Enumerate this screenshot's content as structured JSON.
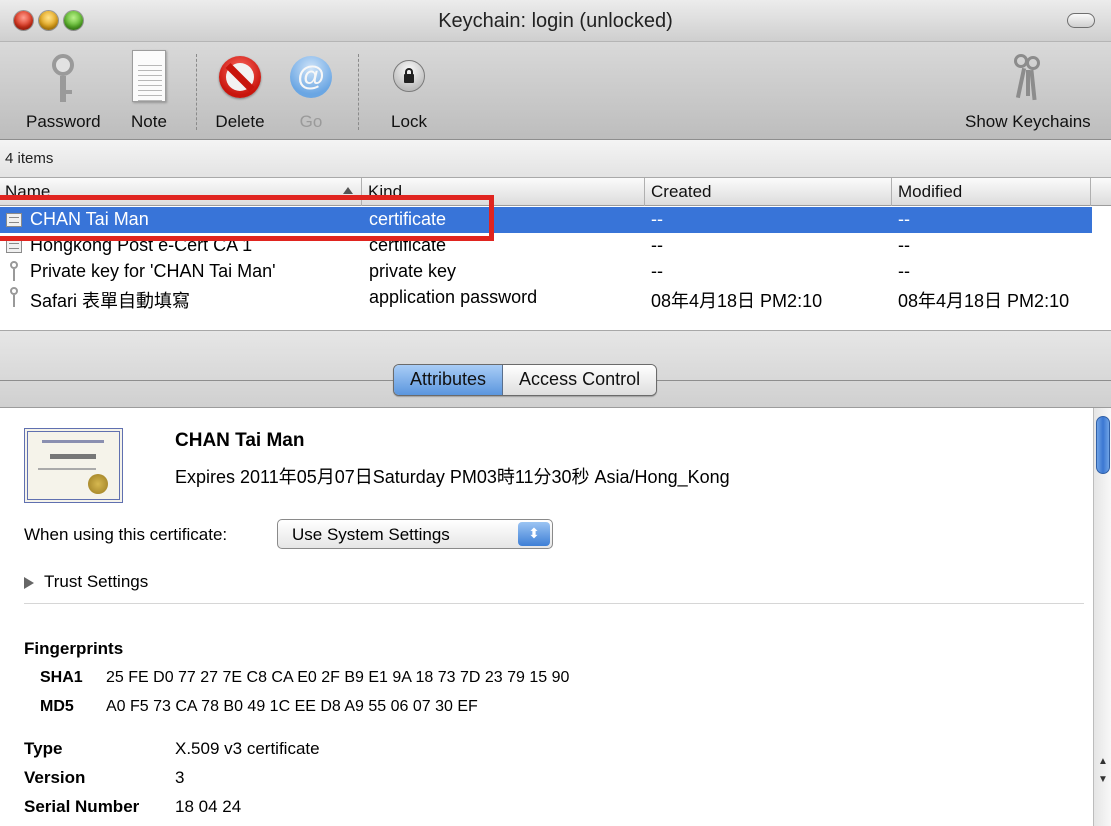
{
  "window": {
    "title": "Keychain: login (unlocked)"
  },
  "toolbar": {
    "items": [
      {
        "label": "Password",
        "icon": "key-icon"
      },
      {
        "label": "Note",
        "icon": "note-icon"
      },
      {
        "label": "Delete",
        "icon": "delete-icon"
      },
      {
        "label": "Go",
        "icon": "at-icon",
        "disabled": true
      },
      {
        "label": "Lock",
        "icon": "lock-icon"
      },
      {
        "label": "Show Keychains",
        "icon": "keys-icon"
      }
    ],
    "go_glyph": "@"
  },
  "count_text": "4 items",
  "table": {
    "columns": [
      "Name",
      "Kind",
      "Created",
      "Modified"
    ],
    "rows": [
      {
        "name": "CHAN Tai Man",
        "kind": "certificate",
        "created": "--",
        "modified": "--",
        "icon": "certificate-icon",
        "selected": true
      },
      {
        "name": "Hongkong Post e-Cert CA 1",
        "kind": "certificate",
        "created": "--",
        "modified": "--",
        "icon": "certificate-icon"
      },
      {
        "name": "Private key for 'CHAN Tai Man'",
        "kind": "private key",
        "created": "--",
        "modified": "--",
        "icon": "key-icon"
      },
      {
        "name": "Safari 表單自動填寫",
        "kind": "application password",
        "created": "08年4月18日 PM2:10",
        "modified": "08年4月18日 PM2:10",
        "icon": "key-icon"
      }
    ]
  },
  "tabs": {
    "attributes": "Attributes",
    "access_control": "Access Control"
  },
  "detail": {
    "title": "CHAN Tai Man",
    "expires": "Expires 2011年05月07日Saturday PM03時11分30秒 Asia/Hong_Kong",
    "when_using_label": "When using this certificate:",
    "when_using_value": "Use System Settings",
    "stepper_glyph": "⬍",
    "trust_settings": "Trust Settings",
    "fingerprints_heading": "Fingerprints",
    "sha1_label": "SHA1",
    "sha1_value": "25 FE D0 77 27 7E C8 CA E0 2F B9 E1 9A 18 73 7D 23 79 15 90",
    "md5_label": "MD5",
    "md5_value": "A0 F5 73 CA 78 B0 49 1C EE D8 A9 55 06 07 30 EF",
    "type_label": "Type",
    "type_value": "X.509 v3 certificate",
    "version_label": "Version",
    "version_value": "3",
    "serial_label": "Serial Number",
    "serial_value": "18 04 24"
  },
  "colors": {
    "selection": "#3874d8",
    "highlight": "#e0241f"
  }
}
